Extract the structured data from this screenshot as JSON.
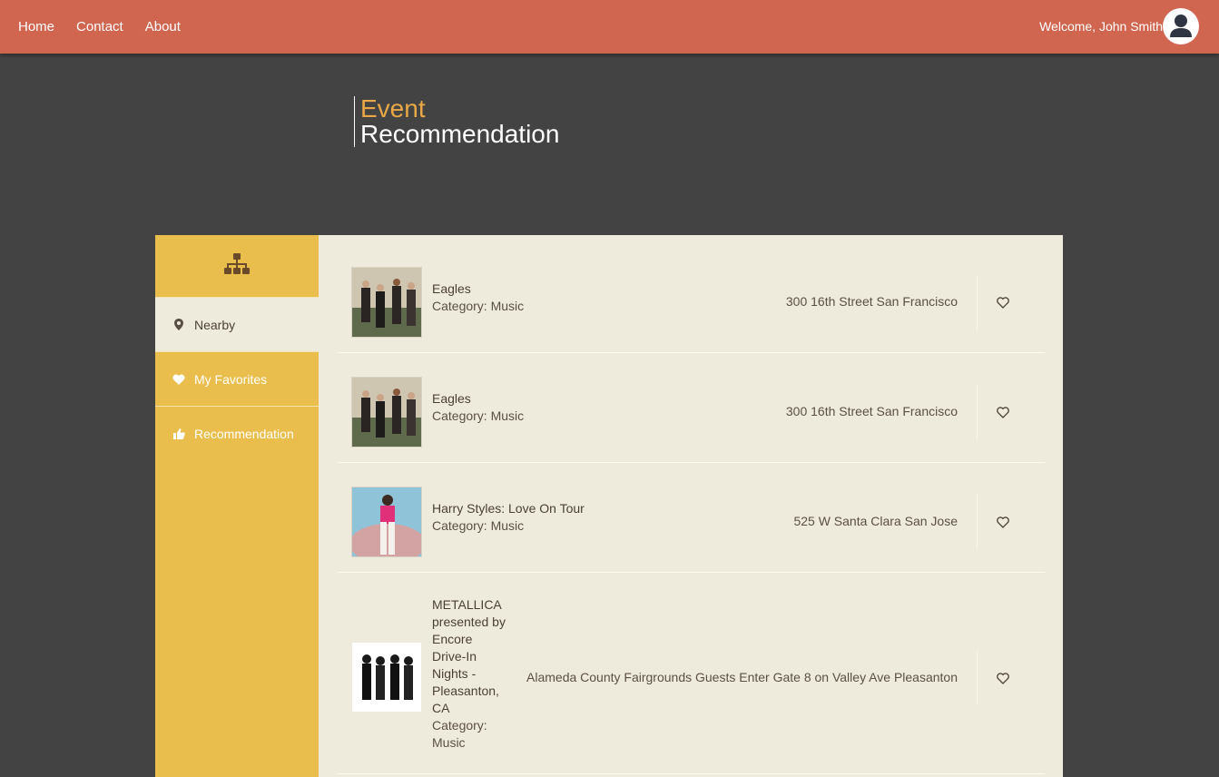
{
  "nav": {
    "home": "Home",
    "contact": "Contact",
    "about": "About"
  },
  "welcome": "Welcome, John Smith",
  "header": {
    "line1": "Event",
    "line2": "Recommendation"
  },
  "sidebar": {
    "items": [
      {
        "label": "Nearby",
        "icon": "map-marker-icon",
        "active": true
      },
      {
        "label": "My Favorites",
        "icon": "heart-icon",
        "active": false
      },
      {
        "label": "Recommendation",
        "icon": "thumbs-up-icon",
        "active": false
      }
    ]
  },
  "events": [
    {
      "name": "Eagles",
      "category": "Category: Music",
      "address": "300 16th Street San Francisco"
    },
    {
      "name": "Eagles",
      "category": "Category: Music",
      "address": "300 16th Street San Francisco"
    },
    {
      "name": "Harry Styles: Love On Tour",
      "category": "Category: Music",
      "address": "525 W Santa Clara San Jose"
    },
    {
      "name": "METALLICA presented by Encore Drive-In Nights - Pleasanton, CA",
      "category": "Category: Music",
      "address": "Alameda County Fairgrounds Guests Enter Gate 8 on Valley Ave Pleasanton"
    }
  ],
  "colors": {
    "topbar": "#d06550",
    "accent": "#e9a846",
    "sidebar": "#e9be4c",
    "content": "#efebdc",
    "background": "#434343"
  }
}
